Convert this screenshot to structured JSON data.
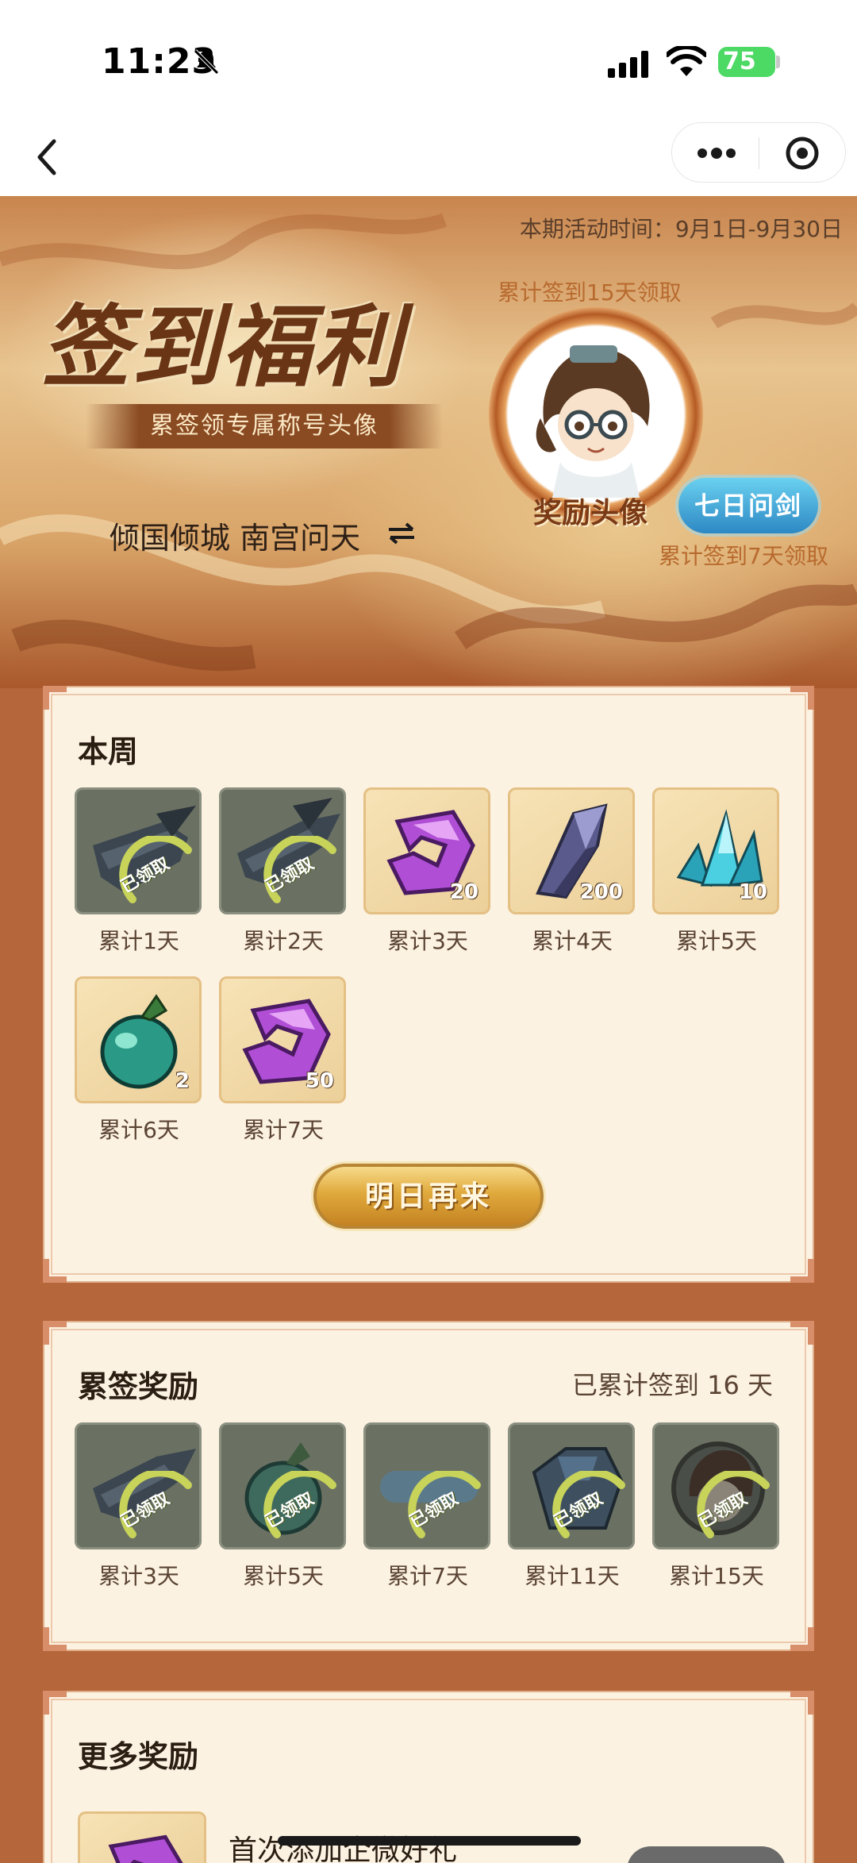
{
  "status_bar": {
    "time": "11:23",
    "battery": "75"
  },
  "nav": {
    "back_icon": "chevron-left-icon",
    "more_icon": "more-dots-icon",
    "close_icon": "target-icon"
  },
  "banner": {
    "activity_time": "本期活动时间：9月1日-9月30日",
    "title": "签到福利",
    "subtitle": "累签领专属称号头像",
    "user_title": "倾国倾城 南宫问天",
    "swap_icon": "swap-arrows-icon",
    "cum15_label": "累计签到15天领取",
    "avatar_tag": "奖励头像",
    "badge": "七日问剑",
    "cum7_label": "累计签到7天领取"
  },
  "week": {
    "title": "本周",
    "items": [
      {
        "label": "累计1天",
        "icon": "sword-icon",
        "claimed": true,
        "claimed_text": "已领取"
      },
      {
        "label": "累计2天",
        "icon": "sword-icon",
        "claimed": true,
        "claimed_text": "已领取"
      },
      {
        "label": "累计3天",
        "icon": "purple-token-icon",
        "count": "20"
      },
      {
        "label": "累计4天",
        "icon": "crystal-shard-icon",
        "count": "200"
      },
      {
        "label": "累计5天",
        "icon": "blue-crystal-icon",
        "count": "10"
      },
      {
        "label": "累计6天",
        "icon": "jade-fruit-icon",
        "count": "2"
      },
      {
        "label": "累计7天",
        "icon": "purple-token-icon",
        "count": "50"
      }
    ],
    "button": "明日再来"
  },
  "cumulative": {
    "title": "累签奖励",
    "summary": "已累计签到 16 天",
    "items": [
      {
        "label": "累计3天",
        "icon": "sword-icon",
        "claimed_text": "已领取"
      },
      {
        "label": "累计5天",
        "icon": "jade-fruit-icon",
        "claimed_text": "已领取"
      },
      {
        "label": "累计7天",
        "icon": "title-badge-icon",
        "claimed_text": "已领取"
      },
      {
        "label": "累计11天",
        "icon": "armor-icon",
        "claimed_text": "已领取"
      },
      {
        "label": "累计15天",
        "icon": "avatar-frame-icon",
        "claimed_text": "已领取"
      }
    ]
  },
  "more": {
    "title": "更多奖励",
    "first_item_text": "首次添加企微好礼",
    "first_item_icon": "purple-token-icon"
  },
  "colors": {
    "accent_gold": "#e0a93c",
    "panel_bg": "#fcf2e2",
    "claimed_green": "#c8d35a",
    "badge_blue": "#2d88c4"
  }
}
